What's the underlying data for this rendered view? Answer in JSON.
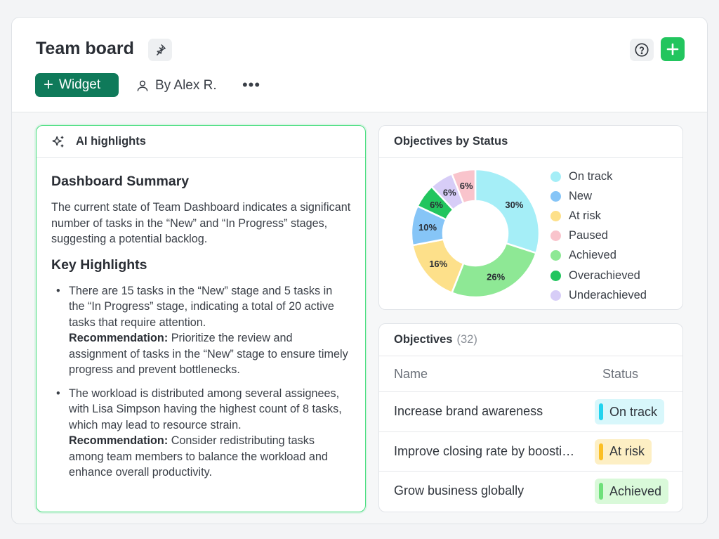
{
  "header": {
    "title": "Team board",
    "widget_label": "Widget",
    "author": "By Alex R.",
    "more_label": "•••"
  },
  "ai_card": {
    "title": "AI highlights",
    "summary_heading": "Dashboard Summary",
    "summary_text": "The current state of Team Dashboard indicates a significant number of tasks in the “New” and “In Progress” stages, suggesting a potential backlog.",
    "highlights_heading": "Key Highlights",
    "highlights": [
      {
        "text": "There are 15 tasks in the “New” stage and 5 tasks in the “In Progress” stage, indicating a total of 20 active tasks that require attention.",
        "rec_label": "Recommendation:",
        "rec_text": " Prioritize the review and assignment of tasks in the “New” stage to ensure timely progress and prevent bottlenecks."
      },
      {
        "text": "The workload is distributed among several assignees, with Lisa Simpson having the highest count of 8 tasks, which may lead to resource strain.",
        "rec_label": "Recommendation:",
        "rec_text": " Consider redistributing tasks among team members to balance the workload and enhance overall productivity."
      }
    ]
  },
  "status_card": {
    "title": "Objectives by Status"
  },
  "chart_data": {
    "type": "pie",
    "donut": true,
    "title": "Objectives by Status",
    "categories": [
      "On track",
      "New",
      "At risk",
      "Paused",
      "Achieved",
      "Overachieved",
      "Underachieved"
    ],
    "slices": [
      {
        "name": "On track",
        "value": 30,
        "label": "30%",
        "color": "#a5eef7"
      },
      {
        "name": "Achieved",
        "value": 26,
        "label": "26%",
        "color": "#8ee895"
      },
      {
        "name": "At risk",
        "value": 16,
        "label": "16%",
        "color": "#fde08a"
      },
      {
        "name": "New",
        "value": 10,
        "label": "10%",
        "color": "#86c5f7"
      },
      {
        "name": "Overachieved",
        "value": 6,
        "label": "6%",
        "color": "#22c55e"
      },
      {
        "name": "Underachieved",
        "value": 6,
        "label": "6%",
        "color": "#d7cdf7"
      },
      {
        "name": "Paused",
        "value": 6,
        "label": "6%",
        "color": "#f9c4cc"
      }
    ],
    "legend": [
      {
        "name": "On track",
        "color": "#a5eef7"
      },
      {
        "name": "New",
        "color": "#86c5f7"
      },
      {
        "name": "At risk",
        "color": "#fde08a"
      },
      {
        "name": "Paused",
        "color": "#f9c4cc"
      },
      {
        "name": "Achieved",
        "color": "#8ee895"
      },
      {
        "name": "Overachieved",
        "color": "#22c55e"
      },
      {
        "name": "Underachieved",
        "color": "#d7cdf7"
      }
    ],
    "legend_position": "right"
  },
  "objectives": {
    "title": "Objectives",
    "count": "(32)",
    "columns": {
      "name": "Name",
      "status": "Status"
    },
    "rows": [
      {
        "name": "Increase brand awareness",
        "status": "On track",
        "bg": "#d8f7fb",
        "bar": "#22d3ee"
      },
      {
        "name": "Improve closing rate by boosting conversions",
        "status": "At risk",
        "bg": "#fdefc4",
        "bar": "#fbbf24"
      },
      {
        "name": "Grow business globally",
        "status": "Achieved",
        "bg": "#d9f9d9",
        "bar": "#6ee07a"
      }
    ]
  }
}
